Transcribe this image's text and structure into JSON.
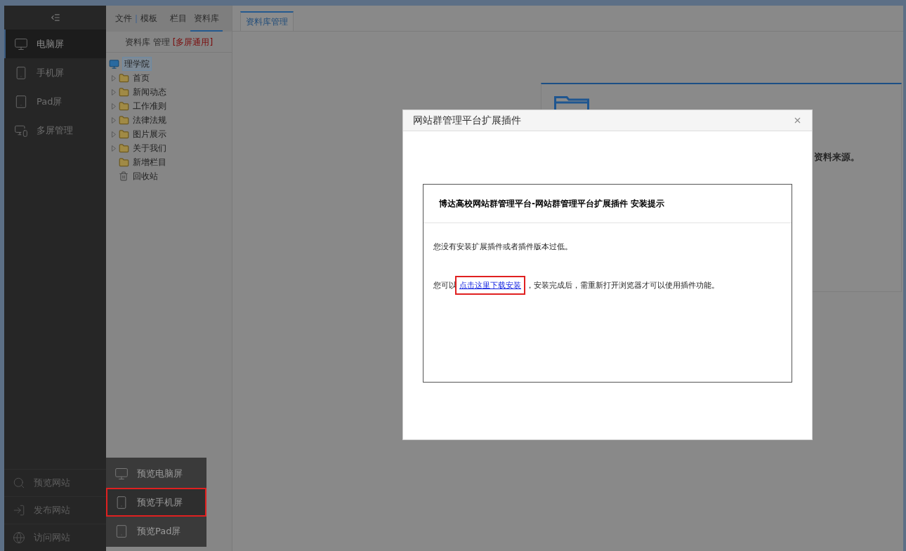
{
  "sidebar": {
    "items": [
      {
        "label": "电脑屏",
        "kind": "monitor",
        "selected": true
      },
      {
        "label": "手机屏",
        "kind": "phone",
        "selected": false
      },
      {
        "label": "Pad屏",
        "kind": "pad",
        "selected": false
      },
      {
        "label": "多屏管理",
        "kind": "multi",
        "selected": false
      }
    ],
    "bottom_items": [
      {
        "label": "预览网站",
        "kind": "preview"
      },
      {
        "label": "发布网站",
        "kind": "publish"
      },
      {
        "label": "访问网站",
        "kind": "globe"
      }
    ]
  },
  "panel": {
    "tabs": [
      {
        "label": "文件",
        "selected": false,
        "separator": false
      },
      {
        "label": "模板",
        "selected": false,
        "separator": true
      },
      {
        "label": "栏目",
        "selected": false,
        "separator": false
      },
      {
        "label": "资料库",
        "selected": true,
        "separator": false
      }
    ],
    "heading": "资料库 管理",
    "tag": "[多屏通用]",
    "tree": {
      "label": "理学院",
      "selected": true,
      "children": [
        {
          "label": "首页",
          "kind": "folder",
          "has_children": true
        },
        {
          "label": "新闻动态",
          "kind": "folder",
          "has_children": true
        },
        {
          "label": "工作准则",
          "kind": "folder",
          "has_children": true
        },
        {
          "label": "法律法规",
          "kind": "folder",
          "has_children": true
        },
        {
          "label": "图片展示",
          "kind": "folder",
          "has_children": true
        },
        {
          "label": "关于我们",
          "kind": "folder",
          "has_children": true
        },
        {
          "label": "新增栏目",
          "kind": "folder",
          "has_children": false
        },
        {
          "label": "回收站",
          "kind": "trash",
          "has_children": false
        }
      ]
    }
  },
  "preview_menu": [
    {
      "label": "预览电脑屏",
      "kind": "monitor",
      "highlighted": false
    },
    {
      "label": "预览手机屏",
      "kind": "phone",
      "highlighted": true
    },
    {
      "label": "预览Pad屏",
      "kind": "pad",
      "highlighted": false
    }
  ],
  "main": {
    "tabs": [
      {
        "label": "资料库管理",
        "selected": true
      }
    ],
    "card": {
      "description": "资料来源。"
    }
  },
  "dialog": {
    "title": "网站群管理平台扩展插件",
    "notice": {
      "heading": "博达高校网站群管理平台-网站群管理平台扩展插件 安装提示",
      "line1": "您没有安装扩展插件或者插件版本过低。",
      "line2_before": "您可以",
      "link": "点击这里下载安装",
      "link_highlighted": true,
      "line2_after": " ，安装完成后，需重新打开浏览器才可以使用插件功能。"
    }
  }
}
